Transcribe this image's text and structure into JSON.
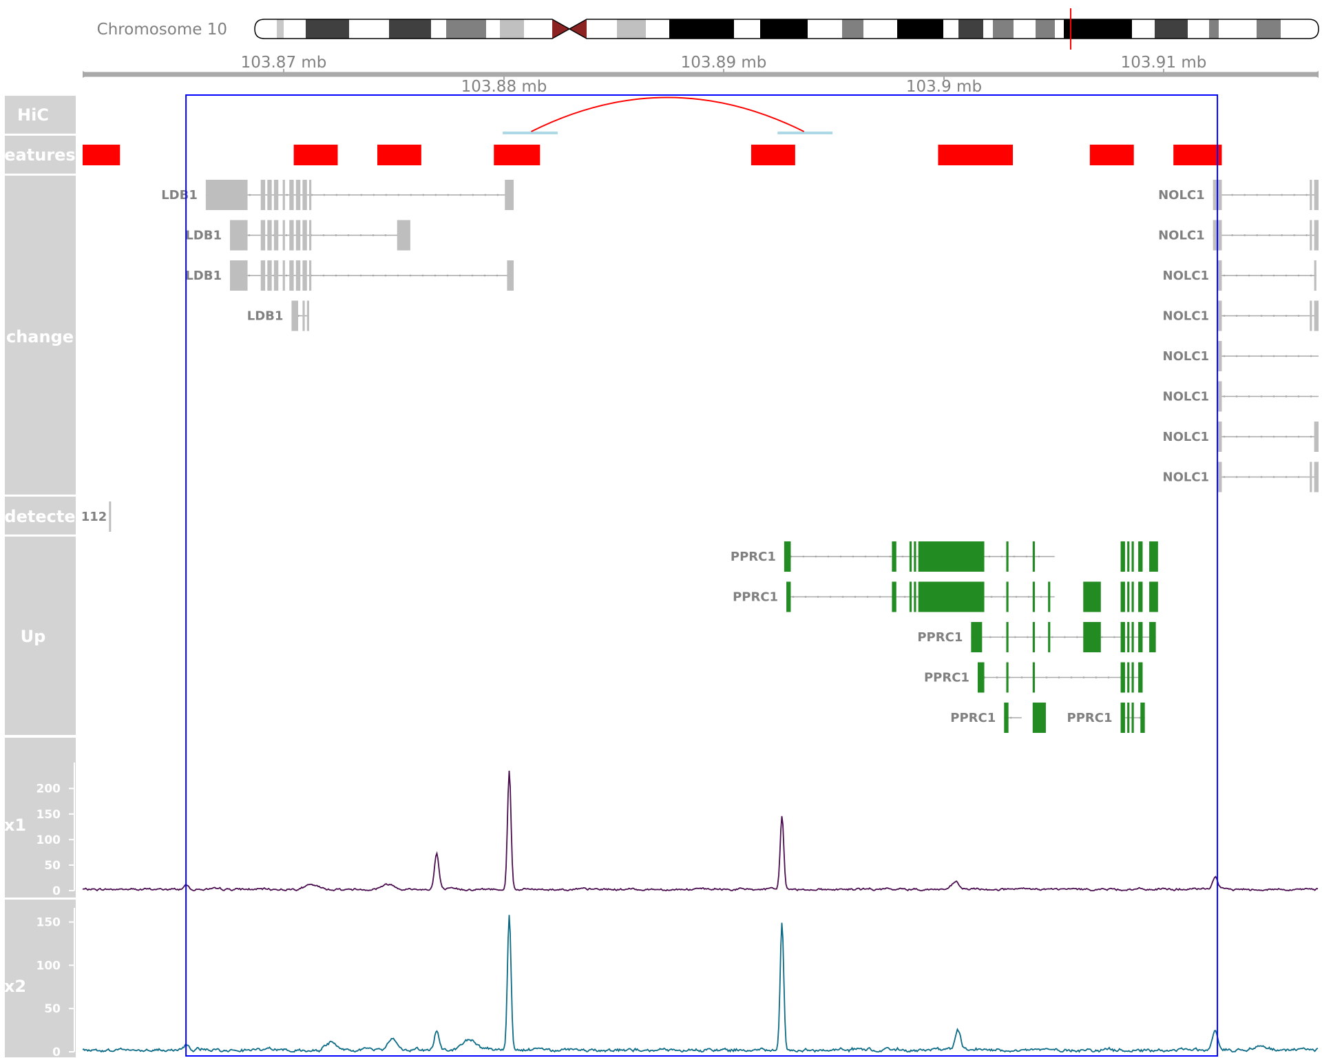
{
  "colors": {
    "panel": "#d3d3d3",
    "gene_grey": "#bebebe",
    "gene_green": "#228b22",
    "feature_red": "#ff0000",
    "hic_anchor": "#add8e6",
    "hic_arc": "#ff0000",
    "highlight": "#0000ff",
    "sample1": "#4a0d4f",
    "sample2": "#0b6a85",
    "ideogram_marker": "#ff0000",
    "centromere": "#8b2323"
  },
  "ideogram": {
    "label": "Chromosome 10"
  },
  "axis": {
    "view_start_mb": 103.8609,
    "view_end_mb": 103.9171,
    "highlight_start_mb": 103.8656,
    "highlight_end_mb": 103.9125,
    "ticks_upper": [
      "103.87 mb",
      "103.89 mb",
      "103.91 mb"
    ],
    "ticks_lower": [
      "103.88 mb",
      "103.9 mb"
    ]
  },
  "tracks": [
    {
      "label": "HiC"
    },
    {
      "label": "eatures"
    },
    {
      "label": "change"
    },
    {
      "label": "detecte"
    },
    {
      "label": "Up"
    },
    {
      "label": "x1"
    },
    {
      "label": "x2"
    }
  ],
  "features": {
    "blocks_mb": [
      [
        103.8609,
        103.8626
      ],
      [
        103.8705,
        103.8725
      ],
      [
        103.8743,
        103.8763
      ],
      [
        103.8796,
        103.8817
      ],
      [
        103.8913,
        103.8933
      ],
      [
        103.8998,
        103.9032
      ],
      [
        103.9067,
        103.9087
      ],
      [
        103.9105,
        103.9127
      ]
    ]
  },
  "hic": {
    "anchors_mb": [
      [
        103.88,
        103.8825
      ],
      [
        103.8925,
        103.895
      ]
    ],
    "arc_mb": [
      103.8813,
      103.8937
    ]
  },
  "genes_changed": [
    {
      "label": "LDB1",
      "row": 0,
      "span_mb": [
        103.8665,
        103.8805
      ],
      "exons_mb": [
        [
          103.8665,
          103.8684
        ],
        [
          103.869,
          103.8692
        ],
        [
          103.8693,
          103.8695
        ],
        [
          103.8696,
          103.8698
        ],
        [
          103.87,
          103.8701
        ],
        [
          103.8703,
          103.8705
        ],
        [
          103.8706,
          103.8708
        ],
        [
          103.8709,
          103.8711
        ],
        [
          103.8712,
          103.8713
        ],
        [
          103.8801,
          103.8805
        ]
      ]
    },
    {
      "label": "LDB1",
      "row": 1,
      "span_mb": [
        103.8676,
        103.8758
      ],
      "exons_mb": [
        [
          103.8676,
          103.8684
        ],
        [
          103.869,
          103.8692
        ],
        [
          103.8693,
          103.8695
        ],
        [
          103.8696,
          103.8698
        ],
        [
          103.87,
          103.8701
        ],
        [
          103.8703,
          103.8705
        ],
        [
          103.8706,
          103.8708
        ],
        [
          103.8709,
          103.8711
        ],
        [
          103.8712,
          103.8713
        ],
        [
          103.8752,
          103.8758
        ]
      ]
    },
    {
      "label": "LDB1",
      "row": 2,
      "span_mb": [
        103.8676,
        103.8805
      ],
      "exons_mb": [
        [
          103.8676,
          103.8684
        ],
        [
          103.869,
          103.8692
        ],
        [
          103.8693,
          103.8695
        ],
        [
          103.8696,
          103.8698
        ],
        [
          103.87,
          103.8701
        ],
        [
          103.8703,
          103.8705
        ],
        [
          103.8706,
          103.8708
        ],
        [
          103.8709,
          103.8711
        ],
        [
          103.8712,
          103.8713
        ],
        [
          103.8802,
          103.8805
        ]
      ]
    },
    {
      "label": "LDB1",
      "row": 3,
      "span_mb": [
        103.8704,
        103.8712
      ],
      "exons_mb": [
        [
          103.8704,
          103.8707
        ],
        [
          103.8709,
          103.871
        ],
        [
          103.8711,
          103.8712
        ]
      ]
    },
    {
      "label": "NOLC1",
      "row": 0,
      "span_mb": [
        103.9123,
        103.9171
      ],
      "exons_mb": [
        [
          103.9123,
          103.9127
        ],
        [
          103.9167,
          103.9168
        ],
        [
          103.9169,
          103.9171
        ]
      ]
    },
    {
      "label": "NOLC1",
      "row": 1,
      "span_mb": [
        103.9123,
        103.9171
      ],
      "exons_mb": [
        [
          103.9123,
          103.9127
        ],
        [
          103.9167,
          103.9168
        ],
        [
          103.9169,
          103.9171
        ]
      ]
    },
    {
      "label": "NOLC1",
      "row": 2,
      "span_mb": [
        103.9125,
        103.917
      ],
      "exons_mb": [
        [
          103.9125,
          103.9127
        ],
        [
          103.9169,
          103.917
        ]
      ]
    },
    {
      "label": "NOLC1",
      "row": 3,
      "span_mb": [
        103.9125,
        103.9171
      ],
      "exons_mb": [
        [
          103.9125,
          103.9127
        ],
        [
          103.9167,
          103.9168
        ],
        [
          103.9169,
          103.9171
        ]
      ]
    },
    {
      "label": "NOLC1",
      "row": 4,
      "span_mb": [
        103.9125,
        103.9171
      ],
      "exons_mb": [
        [
          103.9125,
          103.9127
        ]
      ]
    },
    {
      "label": "NOLC1",
      "row": 5,
      "span_mb": [
        103.9125,
        103.9171
      ],
      "exons_mb": [
        [
          103.9125,
          103.9127
        ]
      ]
    },
    {
      "label": "NOLC1",
      "row": 6,
      "span_mb": [
        103.9125,
        103.9171
      ],
      "exons_mb": [
        [
          103.9125,
          103.9127
        ],
        [
          103.9169,
          103.9171
        ]
      ]
    },
    {
      "label": "NOLC1",
      "row": 7,
      "span_mb": [
        103.9125,
        103.9171
      ],
      "exons_mb": [
        [
          103.9125,
          103.9127
        ],
        [
          103.9167,
          103.9168
        ],
        [
          103.9169,
          103.9171
        ]
      ]
    }
  ],
  "genes_undetected": [
    {
      "label": "112",
      "exon_mb": [
        103.8621,
        103.8622
      ]
    }
  ],
  "genes_up": [
    {
      "label": "PPRC1",
      "row": 0,
      "span_mb": [
        103.8928,
        103.9051
      ],
      "exons_mb": [
        [
          103.8928,
          103.8931
        ],
        [
          103.8977,
          103.8979
        ],
        [
          103.8985,
          103.8986
        ],
        [
          103.8987,
          103.8988
        ],
        [
          103.8989,
          103.9019
        ],
        [
          103.9029,
          103.903
        ],
        [
          103.9041,
          103.9042
        ],
        [
          103.9081,
          103.9083
        ],
        [
          103.9084,
          103.9085
        ],
        [
          103.9086,
          103.9087
        ],
        [
          103.9089,
          103.9091
        ],
        [
          103.9094,
          103.9098
        ]
      ]
    },
    {
      "label": "PPRC1",
      "row": 1,
      "span_mb": [
        103.8929,
        103.9051
      ],
      "exons_mb": [
        [
          103.8929,
          103.8931
        ],
        [
          103.8977,
          103.8979
        ],
        [
          103.8985,
          103.8986
        ],
        [
          103.8987,
          103.8988
        ],
        [
          103.8989,
          103.9019
        ],
        [
          103.9029,
          103.903
        ],
        [
          103.9041,
          103.9042
        ],
        [
          103.9048,
          103.9049
        ],
        [
          103.9064,
          103.9072
        ],
        [
          103.9081,
          103.9083
        ],
        [
          103.9084,
          103.9085
        ],
        [
          103.9086,
          103.9087
        ],
        [
          103.9089,
          103.9091
        ],
        [
          103.9094,
          103.9098
        ]
      ]
    },
    {
      "label": "PPRC1",
      "row": 2,
      "span_mb": [
        103.9013,
        103.9097
      ],
      "exons_mb": [
        [
          103.9013,
          103.9018
        ],
        [
          103.9029,
          103.903
        ],
        [
          103.9041,
          103.9042
        ],
        [
          103.9048,
          103.9049
        ],
        [
          103.9064,
          103.9072
        ],
        [
          103.9081,
          103.9083
        ],
        [
          103.9084,
          103.9085
        ],
        [
          103.9086,
          103.9087
        ],
        [
          103.9089,
          103.9091
        ],
        [
          103.9094,
          103.9097
        ]
      ]
    },
    {
      "label": "PPRC1",
      "row": 3,
      "span_mb": [
        103.9016,
        103.9091
      ],
      "exons_mb": [
        [
          103.9016,
          103.9019
        ],
        [
          103.9029,
          103.903
        ],
        [
          103.9041,
          103.9042
        ],
        [
          103.9081,
          103.9083
        ],
        [
          103.9084,
          103.9085
        ],
        [
          103.9086,
          103.9087
        ],
        [
          103.9089,
          103.9091
        ]
      ]
    },
    {
      "label": "PPRC1",
      "row": 4,
      "span_mb": [
        103.9028,
        103.9036
      ],
      "exons_mb": [
        [
          103.9028,
          103.903
        ],
        [
          103.9041,
          103.9047
        ]
      ]
    },
    {
      "label": "PPRC1",
      "row": 4,
      "span_mb": [
        103.9081,
        103.9092
      ],
      "exons_mb": [
        [
          103.9081,
          103.9083
        ],
        [
          103.9084,
          103.9085
        ],
        [
          103.9086,
          103.9087
        ],
        [
          103.909,
          103.9092
        ]
      ]
    }
  ],
  "chart_data": [
    {
      "type": "area",
      "series": [
        {
          "name": "x1"
        }
      ],
      "ylabel": "",
      "yticks": [
        0,
        50,
        100,
        150,
        200
      ],
      "ylim": [
        0,
        240
      ],
      "baseline_noise": 2.5,
      "peaks": [
        {
          "x_mb": 103.877,
          "height": 70,
          "width_mb": 0.0001
        },
        {
          "x_mb": 103.8803,
          "height": 232,
          "width_mb": 8e-05
        },
        {
          "x_mb": 103.8927,
          "height": 145,
          "width_mb": 8e-05
        },
        {
          "x_mb": 103.8713,
          "height": 8,
          "width_mb": 0.0003
        },
        {
          "x_mb": 103.8748,
          "height": 10,
          "width_mb": 0.0003
        },
        {
          "x_mb": 103.9006,
          "height": 14,
          "width_mb": 0.00015
        },
        {
          "x_mb": 103.9124,
          "height": 25,
          "width_mb": 0.00012
        },
        {
          "x_mb": 103.8656,
          "height": 8,
          "width_mb": 0.00012
        }
      ]
    },
    {
      "type": "area",
      "series": [
        {
          "name": "x2"
        }
      ],
      "ylabel": "",
      "yticks": [
        0,
        50,
        100,
        150
      ],
      "ylim": [
        0,
        160
      ],
      "baseline_noise": 2.2,
      "peaks": [
        {
          "x_mb": 103.877,
          "height": 24,
          "width_mb": 0.0001
        },
        {
          "x_mb": 103.8803,
          "height": 157,
          "width_mb": 8e-05
        },
        {
          "x_mb": 103.8927,
          "height": 148,
          "width_mb": 8e-05
        },
        {
          "x_mb": 103.875,
          "height": 14,
          "width_mb": 0.0002
        },
        {
          "x_mb": 103.8722,
          "height": 10,
          "width_mb": 0.0002
        },
        {
          "x_mb": 103.8785,
          "height": 12,
          "width_mb": 0.0003
        },
        {
          "x_mb": 103.9007,
          "height": 22,
          "width_mb": 0.00012
        },
        {
          "x_mb": 103.9124,
          "height": 24,
          "width_mb": 0.00012
        },
        {
          "x_mb": 103.9145,
          "height": 6,
          "width_mb": 0.0003
        },
        {
          "x_mb": 103.8656,
          "height": 6,
          "width_mb": 0.00012
        }
      ]
    }
  ]
}
